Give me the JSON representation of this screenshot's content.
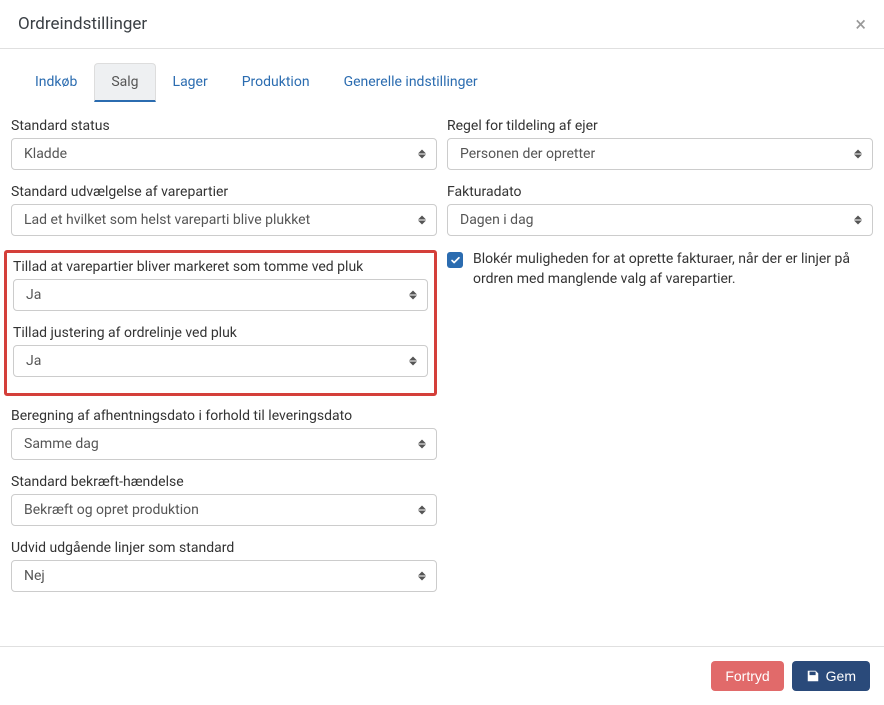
{
  "header": {
    "title": "Ordreindstillinger"
  },
  "tabs": [
    {
      "label": "Indkøb",
      "active": false
    },
    {
      "label": "Salg",
      "active": true
    },
    {
      "label": "Lager",
      "active": false
    },
    {
      "label": "Produktion",
      "active": false
    },
    {
      "label": "Generelle indstillinger",
      "active": false
    }
  ],
  "left": {
    "status": {
      "label": "Standard status",
      "value": "Kladde"
    },
    "batch_selection": {
      "label": "Standard udvælgelse af varepartier",
      "value": "Lad et hvilket som helst vareparti blive plukket"
    },
    "allow_empty": {
      "label": "Tillad at varepartier bliver markeret som tomme ved pluk",
      "value": "Ja"
    },
    "allow_adjust": {
      "label": "Tillad justering af ordrelinje ved pluk",
      "value": "Ja"
    },
    "pickup_calc": {
      "label": "Beregning af afhentningsdato i forhold til leveringsdato",
      "value": "Samme dag"
    },
    "confirm_event": {
      "label": "Standard bekræft-hændelse",
      "value": "Bekræft og opret produktion"
    },
    "expand_lines": {
      "label": "Udvid udgående linjer som standard",
      "value": "Nej"
    }
  },
  "right": {
    "owner_rule": {
      "label": "Regel for tildeling af ejer",
      "value": "Personen der opretter"
    },
    "invoice_date": {
      "label": "Fakturadato",
      "value": "Dagen i dag"
    },
    "block_invoice": {
      "label": "Blokér muligheden for at oprette fakturaer, når der er linjer på ordren med manglende valg af varepartier.",
      "checked": true
    }
  },
  "footer": {
    "cancel": "Fortryd",
    "save": "Gem"
  }
}
